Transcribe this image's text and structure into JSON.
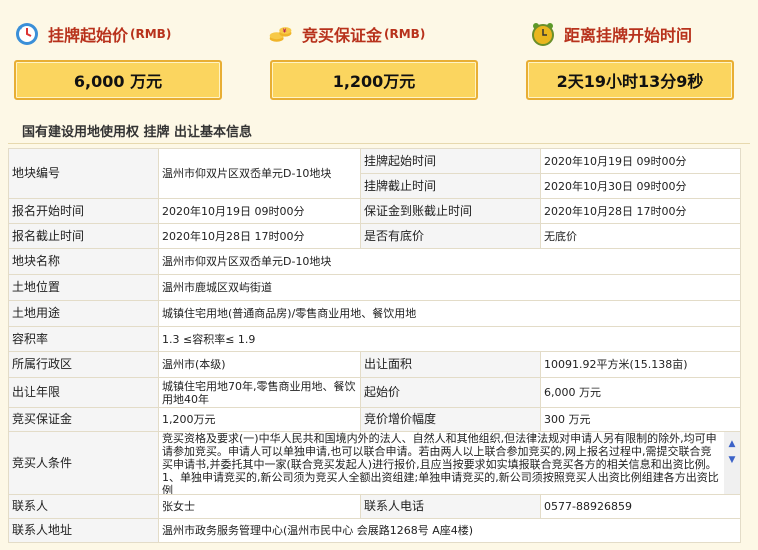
{
  "stats": [
    {
      "label": "挂牌起始价",
      "suffix": "(RMB)",
      "value": "6,000 万元",
      "icon": "clock-refresh-icon"
    },
    {
      "label": "竞买保证金",
      "suffix": "(RMB)",
      "value": "1,200万元",
      "icon": "coins-icon"
    },
    {
      "label": "距离挂牌开始时间",
      "suffix": "",
      "value": "2天19小时13分9秒",
      "icon": "alarm-clock-icon"
    }
  ],
  "section_title": "国有建设用地使用权 挂牌 出让基本信息",
  "table": {
    "plot_no_label": "地块编号",
    "plot_no_value": "温州市仰双片区双岙单元D-10地块",
    "listing_start_label": "挂牌起始时间",
    "listing_start_value": "2020年10月19日 09时00分",
    "listing_end_label": "挂牌截止时间",
    "listing_end_value": "2020年10月30日 09时00分",
    "reg_start_label": "报名开始时间",
    "reg_start_value": "2020年10月19日 09时00分",
    "deposit_deadline_label": "保证金到账截止时间",
    "deposit_deadline_value": "2020年10月28日 17时00分",
    "reg_end_label": "报名截止时间",
    "reg_end_value": "2020年10月28日 17时00分",
    "reserve_label": "是否有底价",
    "reserve_value": "无底价",
    "name_label": "地块名称",
    "name_value": "温州市仰双片区双岙单元D-10地块",
    "location_label": "土地位置",
    "location_value": "温州市鹿城区双屿街道",
    "usage_label": "土地用途",
    "usage_value": "城镇住宅用地(普通商品房)/零售商业用地、餐饮用地",
    "far_label": "容积率",
    "far_value": "1.3 ≤容积率≤ 1.9",
    "district_label": "所属行政区",
    "district_value": "温州市(本级)",
    "area_label": "出让面积",
    "area_value": "10091.92平方米(15.138亩)",
    "term_label": "出让年限",
    "term_value": "城镇住宅用地70年,零售商业用地、餐饮用地40年",
    "start_price_label": "起始价",
    "start_price_value": "6,000 万元",
    "deposit_label": "竞买保证金",
    "deposit_value": "1,200万元",
    "increment_label": "竞价增价幅度",
    "increment_value": "300 万元",
    "conditions_label": "竞买人条件",
    "conditions_value": "竞买资格及要求(一)中华人民共和国境内外的法人、自然人和其他组织,但法律法规对申请人另有限制的除外,均可申请参加竞买。申请人可以单独申请,也可以联合申请。若由两人以上联合参加竞买的,网上报名过程中,需提交联合竞买申请书,并委托其中一家(联合竞买发起人)进行报价,且应当按要求如实填报联合竞买各方的相关信息和出资比例。 1、单独申请竞买的,新公司须为竞买人全额出资组建;单独申请竞买的,新公司须按照竞买人出资比例组建各方出资比例",
    "contact_label": "联系人",
    "contact_value": "张女士",
    "phone_label": "联系人电话",
    "phone_value": "0577-88926859",
    "address_label": "联系人地址",
    "address_value": "温州市政务服务管理中心(温州市民中心 会展路1268号 A座4楼)"
  }
}
